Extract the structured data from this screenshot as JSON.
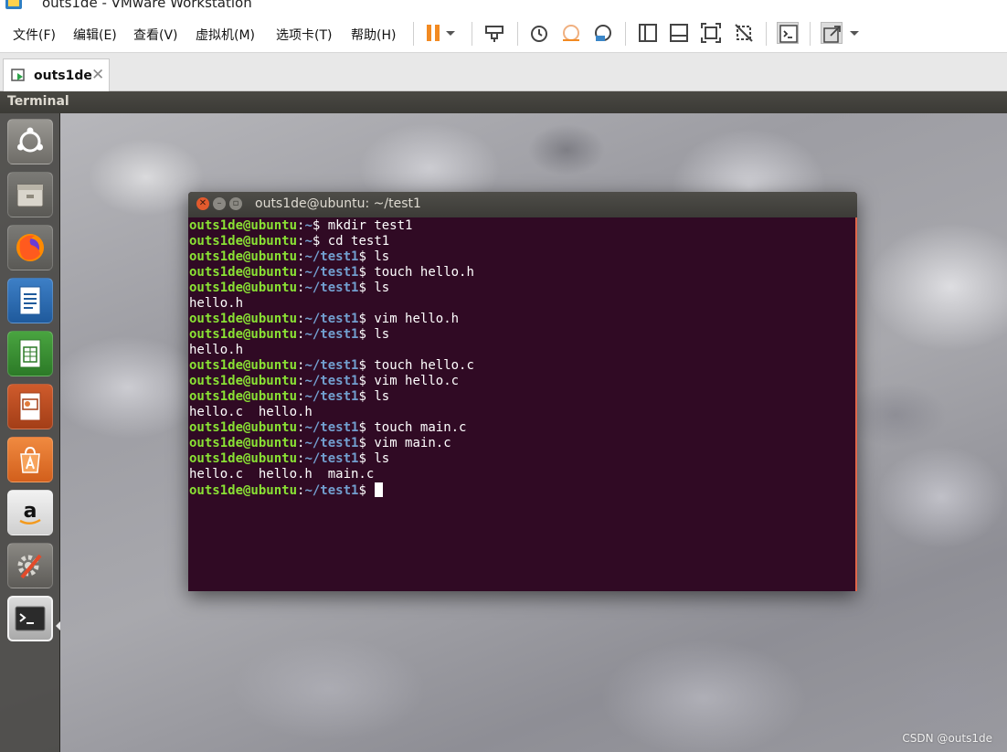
{
  "window": {
    "title": "outs1de - VMware Workstation"
  },
  "menu": [
    {
      "label": "文件(F)"
    },
    {
      "label": "编辑(E)"
    },
    {
      "label": "查看(V)"
    },
    {
      "label": "虚拟机(M)"
    },
    {
      "label": "选项卡(T)"
    },
    {
      "label": "帮助(H)"
    }
  ],
  "toolbar": {
    "icons": [
      "pause-icon",
      "dropdown-icon",
      "send-keys-icon",
      "snapshot-take-icon",
      "snapshot-revert-icon",
      "snapshot-manager-icon",
      "library-view-icon",
      "console-view-icon",
      "fullscreen-icon",
      "unity-icon",
      "terminal-view-icon",
      "stretch-icon"
    ],
    "accent": "#f28a22"
  },
  "tab": {
    "label": "outs1de",
    "close": "✕"
  },
  "guest": {
    "topbar_title": "Terminal",
    "launcher": [
      "ubuntu-dash-icon",
      "files-icon",
      "firefox-icon",
      "writer-icon",
      "calc-icon",
      "impress-icon",
      "software-center-icon",
      "amazon-icon",
      "system-settings-icon",
      "terminal-icon"
    ]
  },
  "terminal": {
    "title": "outs1de@ubuntu: ~/test1",
    "colors": {
      "background": "#300a24",
      "user": "#8ae234",
      "path": "#729fcf"
    },
    "lines": [
      {
        "user": "outs1de@ubuntu",
        "path": "~",
        "cmd": " mkdir test1"
      },
      {
        "user": "outs1de@ubuntu",
        "path": "~",
        "cmd": " cd test1"
      },
      {
        "user": "outs1de@ubuntu",
        "path": "~/test1",
        "cmd": " ls"
      },
      {
        "user": "outs1de@ubuntu",
        "path": "~/test1",
        "cmd": " touch hello.h"
      },
      {
        "user": "outs1de@ubuntu",
        "path": "~/test1",
        "cmd": " ls"
      },
      {
        "out": "hello.h"
      },
      {
        "user": "outs1de@ubuntu",
        "path": "~/test1",
        "cmd": " vim hello.h"
      },
      {
        "user": "outs1de@ubuntu",
        "path": "~/test1",
        "cmd": " ls"
      },
      {
        "out": "hello.h"
      },
      {
        "user": "outs1de@ubuntu",
        "path": "~/test1",
        "cmd": " touch hello.c"
      },
      {
        "user": "outs1de@ubuntu",
        "path": "~/test1",
        "cmd": " vim hello.c"
      },
      {
        "user": "outs1de@ubuntu",
        "path": "~/test1",
        "cmd": " ls"
      },
      {
        "out": "hello.c  hello.h"
      },
      {
        "user": "outs1de@ubuntu",
        "path": "~/test1",
        "cmd": " touch main.c"
      },
      {
        "user": "outs1de@ubuntu",
        "path": "~/test1",
        "cmd": " vim main.c"
      },
      {
        "user": "outs1de@ubuntu",
        "path": "~/test1",
        "cmd": " ls"
      },
      {
        "out": "hello.c  hello.h  main.c"
      },
      {
        "user": "outs1de@ubuntu",
        "path": "~/test1",
        "cmd": " ",
        "cursor": true
      }
    ]
  },
  "watermark": "CSDN @outs1de"
}
